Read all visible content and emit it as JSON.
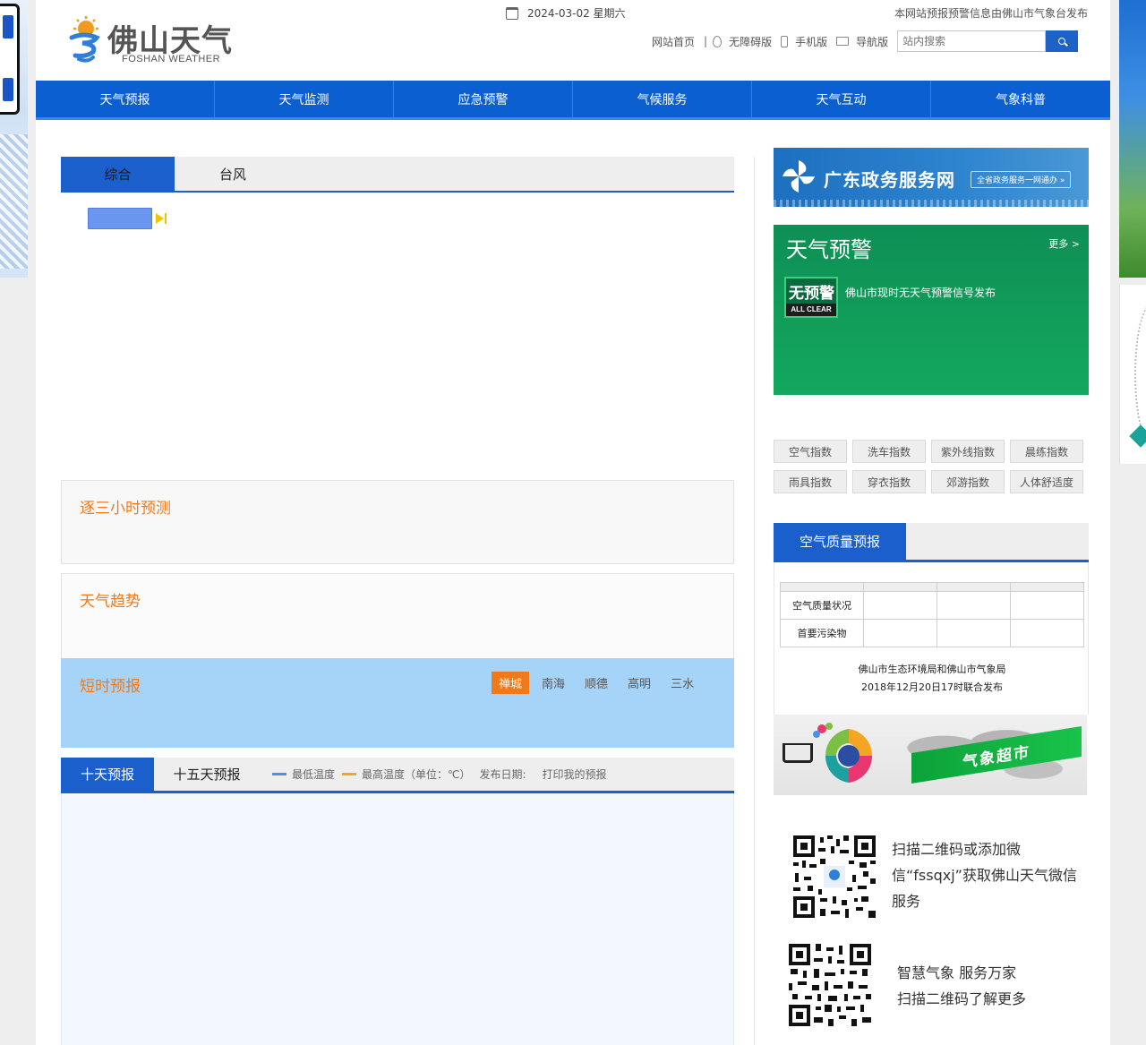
{
  "header": {
    "logo_title": "佛山天气",
    "logo_subtitle": "FOSHAN WEATHER",
    "date": "2024-03-02 星期六",
    "notice": "本网站预报预警信息由佛山市气象台发布",
    "links": {
      "home": "网站首页",
      "separator": "|",
      "accessible": "无障碍版",
      "mobile": "手机版",
      "navigation": "导航版"
    },
    "search": {
      "placeholder": "站内搜索"
    }
  },
  "nav": [
    "天气预报",
    "天气监测",
    "应急预警",
    "气候服务",
    "天气互动",
    "气象科普"
  ],
  "main_tabs": [
    "综合",
    "台风"
  ],
  "sections": {
    "three_hour": "逐三小时预测",
    "trend": "天气趋势",
    "short_term": "短时预报",
    "short_term_districts": [
      "禅城",
      "南海",
      "顺德",
      "高明",
      "三水"
    ]
  },
  "forecast_tabs": {
    "ten_day": "十天预报",
    "fifteen_day": "十五天预报",
    "legend_low": "最低温度",
    "legend_high": "最高温度（单位：℃）",
    "publish_label": "发布日期:",
    "print_label": "打印我的预报",
    "low_color": "#4a90e2",
    "high_color": "#f5a623"
  },
  "sidebar": {
    "gov_banner_title": "广东政务服务网",
    "gov_banner_sub": "全省政务服务一网通办 »",
    "warning_title": "天气预警",
    "warning_more": "更多 >",
    "warning_badge": "无预警",
    "warning_badge_en": "ALL CLEAR",
    "warning_message": "佛山市现时无天气预警信号发布",
    "indices": [
      "空气指数",
      "洗车指数",
      "紫外线指数",
      "晨练指数",
      "雨具指数",
      "穿衣指数",
      "郊游指数",
      "人体舒适度"
    ],
    "air_quality": {
      "title": "空气质量预报",
      "rows": [
        "空气质量状况",
        "首要污染物"
      ],
      "note_line1": "佛山市生态环境局和佛山市气象局",
      "note_line2": "2018年12月20日17时联合发布"
    },
    "market_label": "气象超市",
    "wechat_text": "扫描二维码或添加微信“fssqxj”获取佛山天气微信服务",
    "smart_line1": "智慧气象  服务万家",
    "smart_line2": "扫描二维码了解更多"
  }
}
